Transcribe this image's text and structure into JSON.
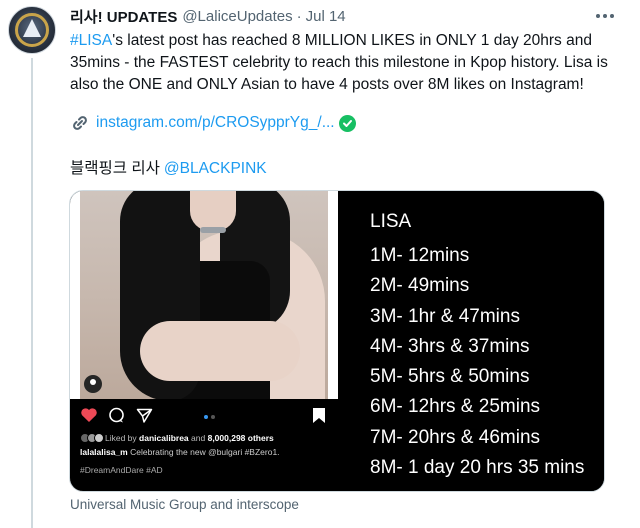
{
  "tweet": {
    "display_name": "리사! UPDATES",
    "handle": "@LaliceUpdates",
    "separator": "·",
    "date": "Jul 14",
    "body": {
      "hashtag": "#LISA",
      "text": "'s latest post has reached 8 MILLION LIKES in ONLY 1 day 20hrs and 35mins - the FASTEST celebrity to reach this milestone in Kpop history. Lisa is also the ONE and ONLY Asian to have 4 posts over 8M likes on Instagram!"
    },
    "link": "instagram.com/p/CROSypprYg_/...",
    "korean_text": "블랙핑크 리사",
    "mention": "@BLACKPINK",
    "media_caption": "Universal Music Group and interscope"
  },
  "instagram_post": {
    "liked_by_prefix": "Liked by",
    "liked_by_user": "danicalibrea",
    "liked_by_and": "and",
    "liked_by_count": "8,000,298 others",
    "caption_user": "lalalalisa_m",
    "caption_text": "Celebrating the new @bulgari #BZero1.",
    "hashtag": "#DreamAndDare #AD"
  },
  "milestones": {
    "title": "LISA",
    "items": [
      "1M- 12mins",
      "2M- 49mins",
      "3M- 1hr & 47mins",
      "4M- 3hrs & 37mins",
      "5M- 5hrs & 50mins",
      "6M- 12hrs & 25mins",
      "7M- 20hrs & 46mins",
      "8M- 1 day 20 hrs 35 mins"
    ]
  },
  "colors": {
    "accent": "#1d9bf0",
    "text": "#0f1419",
    "muted": "#536471",
    "verified": "#17bf63",
    "like_heart": "#ed4956"
  },
  "icons": [
    "more-dots-icon",
    "link-icon",
    "verified-check-icon",
    "heart-icon",
    "comment-icon",
    "share-icon",
    "bookmark-icon",
    "user-tag-icon"
  ]
}
